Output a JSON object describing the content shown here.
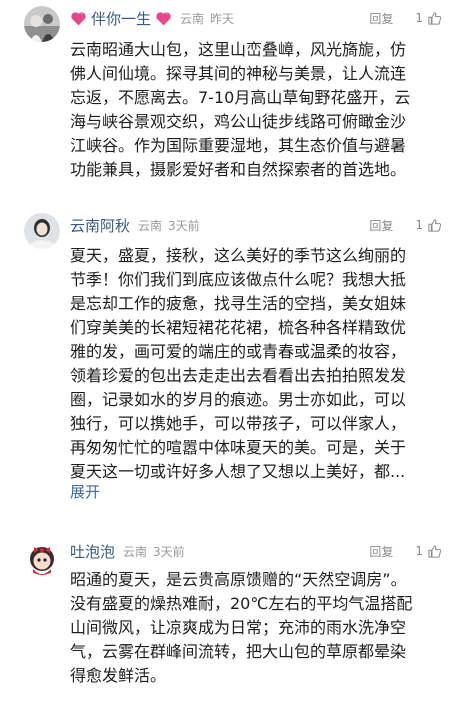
{
  "comments": [
    {
      "username": "伴你一生",
      "has_heart_badges": true,
      "location": "云南",
      "time": "昨天",
      "reply_label": "回复",
      "likes": "1",
      "body_lines": [
        "云南昭通大山包，这里山峦叠嶂，风光旖旎，仿",
        "佛人间仙境。探寻其间的神秘与美景，让人流连",
        "忘返，不愿离去。7-10月高山草甸野花盛开，云",
        "海与峡谷景观交织，鸡公山徒步线路可俯瞰金沙",
        "江峡谷。作为国际重要湿地，其生态价值与避暑",
        "功能兼具，摄影爱好者和自然探索者的首选地。"
      ]
    },
    {
      "username": "云南阿秋",
      "has_heart_badges": false,
      "location": "云南",
      "time": "3天前",
      "reply_label": "回复",
      "likes": "1",
      "body_lines": [
        "夏天，盛夏，接秋，这么美好的季节这么绚丽的",
        "节季！你们我们到底应该做点什么呢？我想大抵",
        "是忘却工作的疲惫，找寻生活的空挡，美女姐妹",
        "们穿美美的长裙短裙花花裙，梳各种各样精致优",
        "雅的发，画可爱的端庄的或青春或温柔的妆容，",
        "领着珍爱的包出去走走出去看看出去拍拍照发发",
        "圈，记录如水的岁月的痕迹。男士亦如此，可以",
        "独行，可以携她手，可以带孩子，可以伴家人，",
        "再匆匆忙忙的喧嚣中体味夏天的美。可是，关于",
        "夏天这一切或许好多人想了又想以上美好，都..."
      ],
      "expand_label": "展开"
    },
    {
      "username": "吐泡泡",
      "has_heart_badges": false,
      "location": "云南",
      "time": "3天前",
      "reply_label": "回复",
      "likes": "1",
      "body_lines": [
        "昭通的夏天，是云贵高原馈赠的“天然空调房”。",
        "没有盛夏的燥热难耐，20℃左右的平均气温搭配",
        "山间微风，让凉爽成为日常；充沛的雨水洗净空",
        "气，云雾在群峰间流转，把大山包的草原都晕染",
        "得愈发鲜活。"
      ]
    }
  ],
  "colors": {
    "username": "#3a5a80",
    "meta": "#9a9a9a",
    "body": "#1e1e1e",
    "expand": "#3b6aa8",
    "heart": "#e8458b"
  },
  "icons": {
    "heart_badge": "heart-icon",
    "like": "thumbs-up-icon"
  }
}
